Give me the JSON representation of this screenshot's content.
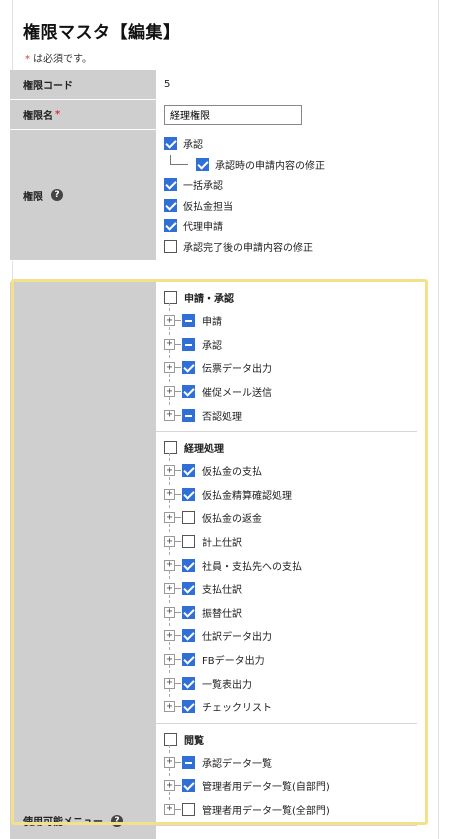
{
  "page": {
    "title": "権限マスタ【編集】",
    "required_star": "*",
    "required_note": "は必須です。"
  },
  "form": {
    "code": {
      "label": "権限コード",
      "value": "5"
    },
    "name": {
      "label": "権限名",
      "required_star": "*",
      "value": "経理権限"
    },
    "permissions": {
      "label": "権限",
      "help_icon": "?",
      "items": [
        {
          "label": "承認",
          "checked": true
        },
        {
          "label": "承認時の申請内容の修正",
          "checked": true,
          "child": true
        },
        {
          "label": "一括承認",
          "checked": true
        },
        {
          "label": "仮払金担当",
          "checked": true
        },
        {
          "label": "代理申請",
          "checked": true
        },
        {
          "label": "承認完了後の申請内容の修正",
          "checked": false
        }
      ]
    },
    "menus": {
      "label": "使用可能メニュー",
      "help_icon": "?",
      "groups": [
        {
          "title": "申請・承認",
          "checked": false,
          "items": [
            {
              "label": "申請",
              "state": "partial"
            },
            {
              "label": "承認",
              "state": "partial"
            },
            {
              "label": "伝票データ出力",
              "state": "checked"
            },
            {
              "label": "催促メール送信",
              "state": "checked"
            },
            {
              "label": "否認処理",
              "state": "partial"
            }
          ]
        },
        {
          "title": "経理処理",
          "checked": false,
          "items": [
            {
              "label": "仮払金の支払",
              "state": "checked"
            },
            {
              "label": "仮払金精算確認処理",
              "state": "checked"
            },
            {
              "label": "仮払金の返金",
              "state": "unchecked"
            },
            {
              "label": "計上仕訳",
              "state": "unchecked"
            },
            {
              "label": "社員・支払先への支払",
              "state": "checked"
            },
            {
              "label": "支払仕訳",
              "state": "checked"
            },
            {
              "label": "振替仕訳",
              "state": "checked"
            },
            {
              "label": "仕訳データ出力",
              "state": "checked"
            },
            {
              "label": "FBデータ出力",
              "state": "checked"
            },
            {
              "label": "一覧表出力",
              "state": "checked"
            },
            {
              "label": "チェックリスト",
              "state": "checked"
            }
          ]
        },
        {
          "title": "閲覧",
          "checked": false,
          "items": [
            {
              "label": "承認データ一覧",
              "state": "partial"
            },
            {
              "label": "管理者用データ一覧(自部門)",
              "state": "checked"
            },
            {
              "label": "管理者用データ一覧(全部門)",
              "state": "unchecked"
            }
          ]
        }
      ]
    }
  },
  "tree": {
    "expand_symbol": "+"
  },
  "colors": {
    "accent": "#2f6fd6",
    "label_bg": "#cfcfcf",
    "highlight": "#f5e08a",
    "required": "#d9363e"
  }
}
